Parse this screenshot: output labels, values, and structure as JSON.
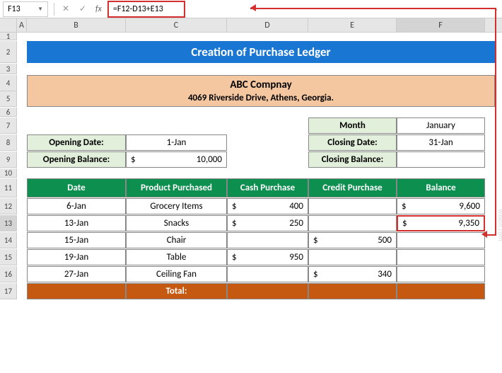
{
  "namebox": "F13",
  "formula": "=F12-D13+E13",
  "cols": {
    "A": "A",
    "B": "B",
    "C": "C",
    "D": "D",
    "E": "E",
    "F": "F"
  },
  "rows": {
    "1": "1",
    "2": "2",
    "3": "3",
    "4": "4",
    "5": "5",
    "6": "6",
    "7": "7",
    "8": "8",
    "9": "9",
    "10": "10",
    "11": "11",
    "12": "12",
    "13": "13",
    "14": "14",
    "15": "15",
    "16": "16",
    "17": "17"
  },
  "title": "Creation of Purchase Ledger",
  "company": {
    "name": "ABC Compnay",
    "addr": "4069 Riverside Drive, Athens, Georgia."
  },
  "info": {
    "month_lbl": "Month",
    "month_val": "January",
    "open_date_lbl": "Opening Date:",
    "open_date_val": "1-Jan",
    "close_date_lbl": "Closing Date:",
    "close_date_val": "31-Jan",
    "open_bal_lbl": "Opening Balance:",
    "open_bal_sym": "$",
    "open_bal_val": "10,000",
    "close_bal_lbl": "Closing Balance:",
    "close_bal_val": ""
  },
  "headers": {
    "date": "Date",
    "product": "Product Purchased",
    "cash": "Cash Purchase",
    "credit": "Credit Purchase",
    "balance": "Balance"
  },
  "data": [
    {
      "date": "6-Jan",
      "product": "Grocery Items",
      "cash_sym": "$",
      "cash": "400",
      "credit_sym": "",
      "credit": "",
      "bal_sym": "$",
      "bal": "9,600"
    },
    {
      "date": "13-Jan",
      "product": "Snacks",
      "cash_sym": "$",
      "cash": "250",
      "credit_sym": "",
      "credit": "",
      "bal_sym": "$",
      "bal": "9,350"
    },
    {
      "date": "15-Jan",
      "product": "Chair",
      "cash_sym": "",
      "cash": "",
      "credit_sym": "$",
      "credit": "500",
      "bal_sym": "",
      "bal": ""
    },
    {
      "date": "19-Jan",
      "product": "Table",
      "cash_sym": "$",
      "cash": "950",
      "credit_sym": "",
      "credit": "",
      "bal_sym": "",
      "bal": ""
    },
    {
      "date": "27-Jan",
      "product": "Ceiling Fan",
      "cash_sym": "",
      "cash": "",
      "credit_sym": "$",
      "credit": "340",
      "bal_sym": "",
      "bal": ""
    }
  ],
  "total_lbl": "Total:",
  "watermark": "wsxdn.com"
}
